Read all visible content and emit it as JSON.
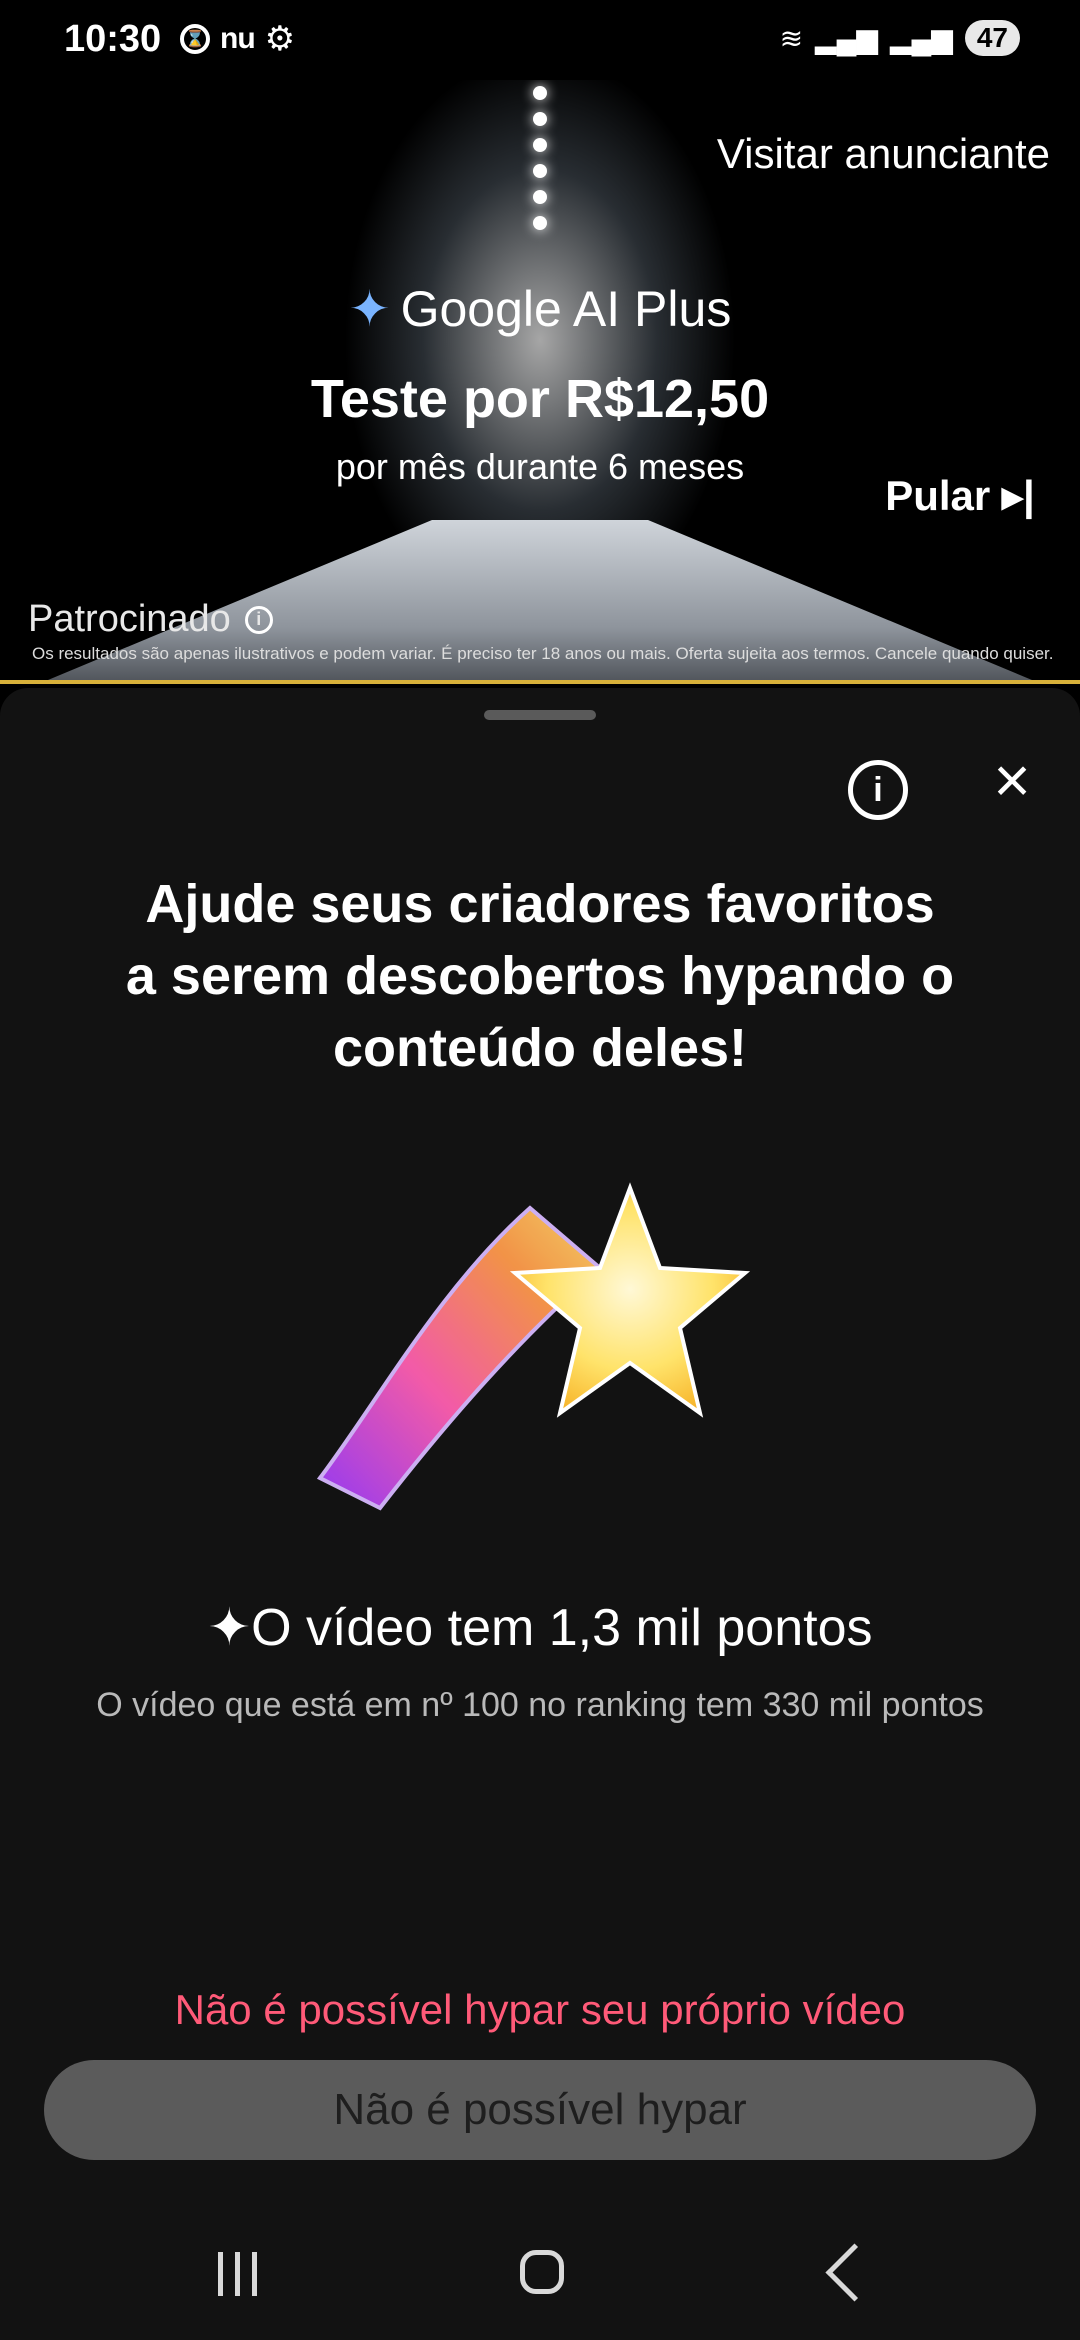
{
  "status_bar": {
    "time": "10:30",
    "nu_label": "nu",
    "battery": "47"
  },
  "ad": {
    "visit_label": "Visitar anunciante",
    "brand": "Google AI Plus",
    "offer_title": "Teste por R$12,50",
    "offer_subtitle": "por mês durante 6 meses",
    "skip_label": "Pular ▸|",
    "sponsored_label": "Patrocinado",
    "disclaimer": "Os resultados são apenas ilustrativos e podem variar. É preciso ter 18 anos ou mais. Oferta sujeita aos termos. Cancele quando quiser."
  },
  "sheet": {
    "title_line1": "Ajude seus criadores favoritos",
    "title_line2": "a serem descobertos hypando o",
    "title_line3": "conteúdo deles!",
    "points_text": "O vídeo tem 1,3 mil pontos",
    "rank_text": "O vídeo que está em nº 100 no ranking tem 330 mil pontos",
    "warning_text": "Não é possível hypar seu próprio vídeo",
    "button_label": "Não é possível hypar"
  },
  "colors": {
    "warning": "#ff5a78",
    "button_bg": "#5b5b5b",
    "accent_line": "#d8b13a"
  },
  "icons": [
    "settings-icon",
    "wifi-icon",
    "signal-icon",
    "info-icon",
    "close-icon",
    "shooting-star-icon",
    "recent-apps-icon",
    "home-icon",
    "back-icon"
  ]
}
